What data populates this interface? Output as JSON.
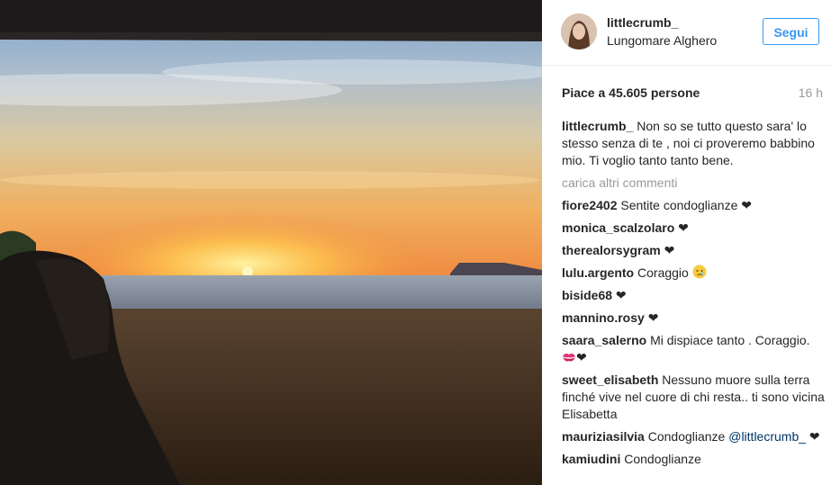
{
  "post": {
    "username": "littlecrumb_",
    "location": "Lungomare Alghero",
    "follow_label": "Segui",
    "likes": "Piace a 45.605 persone",
    "time": "16 h",
    "load_more": "carica altri commenti"
  },
  "caption": {
    "author": "littlecrumb_",
    "text": "Non so se tutto questo sara' lo stesso senza di te , noi ci proveremo babbino mio. Ti voglio tanto tanto bene."
  },
  "comments": [
    {
      "author": "fiore2402",
      "text": "Sentite condoglianze",
      "heart": "❤"
    },
    {
      "author": "monica_scalzolaro",
      "text": "",
      "heart": "❤"
    },
    {
      "author": "therealorsygram",
      "text": "",
      "heart": "❤"
    },
    {
      "author": "lulu.argento",
      "text": "Coraggio",
      "emoji": "crying-face-icon"
    },
    {
      "author": "biside68",
      "text": "",
      "heart": "❤"
    },
    {
      "author": "mannino.rosy",
      "text": "",
      "heart": "❤"
    },
    {
      "author": "saara_salerno",
      "text": "Mi dispiace tanto . Coraggio.",
      "emoji": "kiss-mark-icon",
      "heart": "❤"
    },
    {
      "author": "sweet_elisabeth",
      "text": "Nessuno muore sulla terra finché vive nel cuore di chi resta.. ti sono vicina Elisabetta"
    },
    {
      "author": "mauriziasilvia",
      "text": "Condoglianze",
      "mention": "@littlecrumb_",
      "heart": "❤"
    },
    {
      "author": "kamiudini",
      "text": "Condoglianze"
    }
  ]
}
